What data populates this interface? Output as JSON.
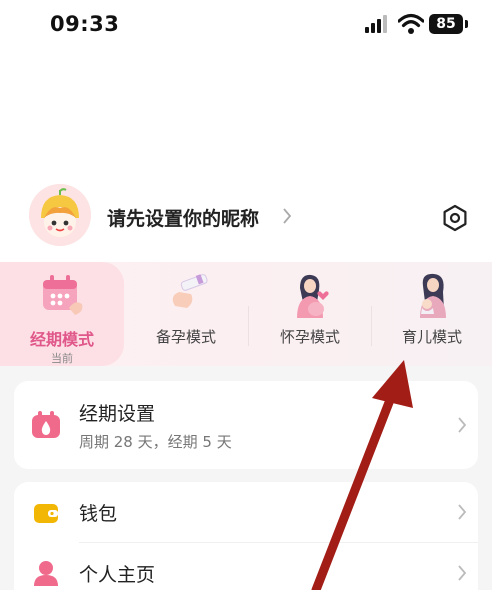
{
  "status_bar": {
    "time": "09:33",
    "battery": "85"
  },
  "profile": {
    "nickname": "请先设置你的昵称"
  },
  "modes": [
    {
      "label": "经期模式",
      "sub": "当前"
    },
    {
      "label": "备孕模式"
    },
    {
      "label": "怀孕模式"
    },
    {
      "label": "育儿模式"
    }
  ],
  "period_card": {
    "title": "经期设置",
    "subtitle": "周期 28 天，经期 5 天"
  },
  "menu": [
    {
      "label": "钱包",
      "icon": "wallet-icon"
    },
    {
      "label": "个人主页",
      "icon": "person-icon"
    }
  ],
  "colors": {
    "accent": "#e0578a",
    "arrow": "#a31d17",
    "wallet": "#f2b705",
    "person": "#f06a8c",
    "period": "#f06a8c"
  }
}
